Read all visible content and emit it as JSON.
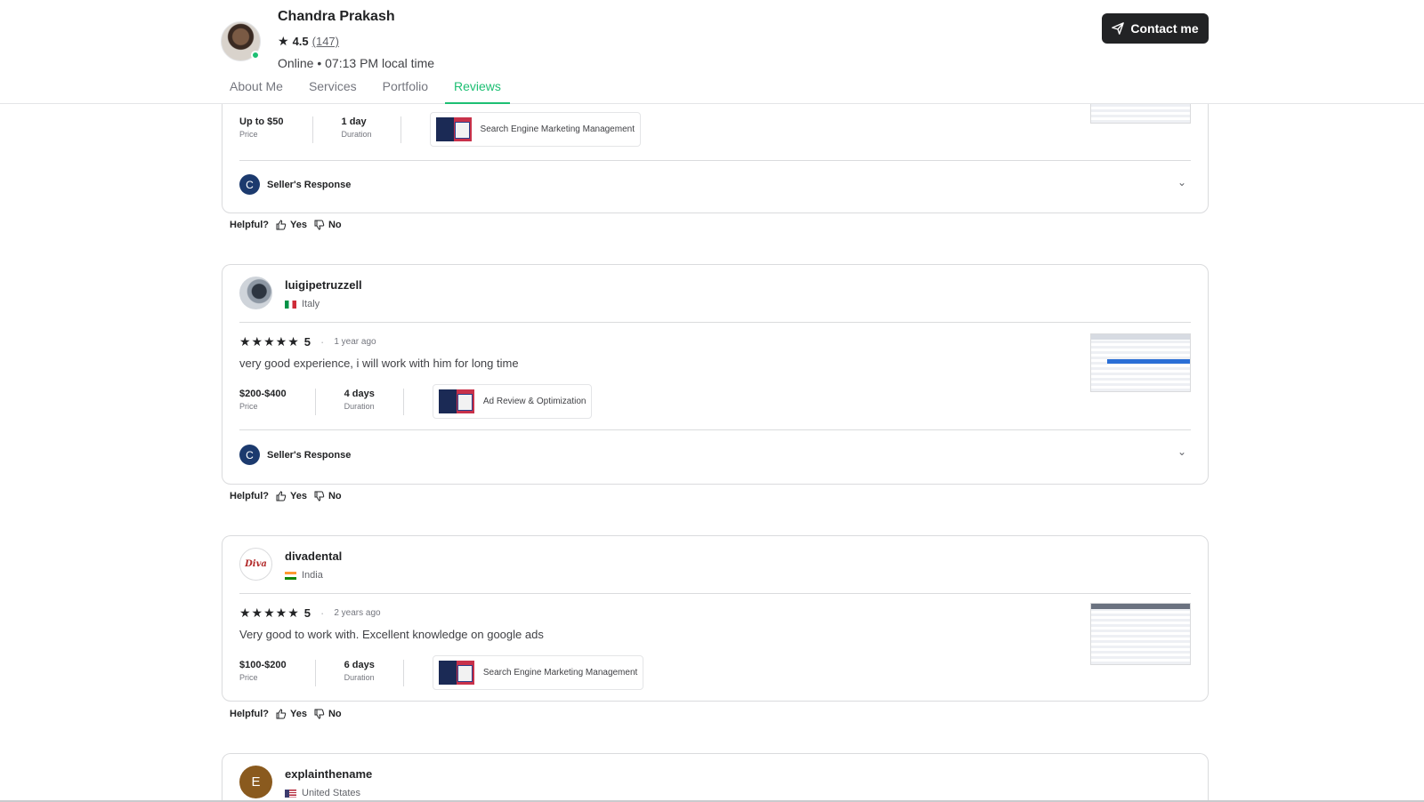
{
  "seller": {
    "name": "Chandra Prakash",
    "rating": "4.5",
    "review_count": "(147)",
    "status": "Online • 07:13 PM local time",
    "contact_label": "Contact me"
  },
  "tabs": [
    {
      "label": "About Me"
    },
    {
      "label": "Services"
    },
    {
      "label": "Portfolio"
    },
    {
      "label": "Reviews"
    }
  ],
  "active_tab": "Reviews",
  "reviews": [
    {
      "price": "Up to $50",
      "price_label": "Price",
      "duration": "1 day",
      "duration_label": "Duration",
      "service": "Search Engine Marketing Management",
      "seller_response_label": "Seller's Response",
      "seller_response_initial": "C"
    },
    {
      "username": "luigipetruzzell",
      "country": "Italy",
      "rating": "5",
      "stars": "★★★★★",
      "time_ago": "1 year ago",
      "text": "very good experience, i will work with him for long time",
      "price": "$200-$400",
      "price_label": "Price",
      "duration": "4 days",
      "duration_label": "Duration",
      "service": "Ad Review & Optimization",
      "seller_response_label": "Seller's Response",
      "seller_response_initial": "C"
    },
    {
      "username": "divadental",
      "country": "India",
      "rating": "5",
      "stars": "★★★★★",
      "time_ago": "2 years ago",
      "text": "Very good to work with. Excellent knowledge on google ads",
      "price": "$100-$200",
      "price_label": "Price",
      "duration": "6 days",
      "duration_label": "Duration",
      "service": "Search Engine Marketing Management"
    },
    {
      "username": "explainthename",
      "country": "United States",
      "avatar_initial": "E"
    }
  ],
  "helpful": {
    "label": "Helpful?",
    "yes": "Yes",
    "no": "No"
  },
  "colors": {
    "accent_green": "#1dbf73",
    "dark": "#222325",
    "seller_avatar": "#1c3a6e",
    "explain_avatar": "#8a5a1e"
  }
}
